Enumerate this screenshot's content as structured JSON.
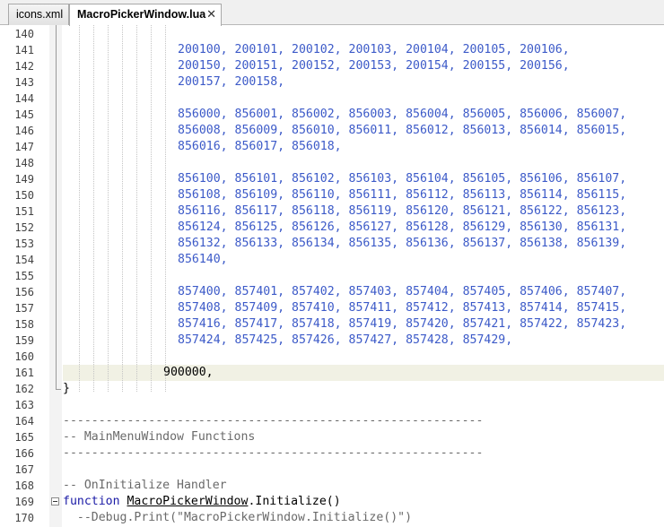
{
  "tabs": [
    {
      "label": "icons.xml",
      "active": false
    },
    {
      "label": "MacroPickerWindow.lua",
      "active": true,
      "close": "✕"
    }
  ],
  "lines": [
    {
      "n": "140",
      "text": ""
    },
    {
      "n": "141",
      "text": "200100, 200101, 200102, 200103, 200104, 200105, 200106,"
    },
    {
      "n": "142",
      "text": "200150, 200151, 200152, 200153, 200154, 200155, 200156,"
    },
    {
      "n": "143",
      "text": "200157, 200158,"
    },
    {
      "n": "144",
      "text": ""
    },
    {
      "n": "145",
      "text": "856000, 856001, 856002, 856003, 856004, 856005, 856006, 856007,"
    },
    {
      "n": "146",
      "text": "856008, 856009, 856010, 856011, 856012, 856013, 856014, 856015,"
    },
    {
      "n": "147",
      "text": "856016, 856017, 856018,"
    },
    {
      "n": "148",
      "text": ""
    },
    {
      "n": "149",
      "text": "856100, 856101, 856102, 856103, 856104, 856105, 856106, 856107,"
    },
    {
      "n": "150",
      "text": "856108, 856109, 856110, 856111, 856112, 856113, 856114, 856115,"
    },
    {
      "n": "151",
      "text": "856116, 856117, 856118, 856119, 856120, 856121, 856122, 856123,"
    },
    {
      "n": "152",
      "text": "856124, 856125, 856126, 856127, 856128, 856129, 856130, 856131,"
    },
    {
      "n": "153",
      "text": "856132, 856133, 856134, 856135, 856136, 856137, 856138, 856139,"
    },
    {
      "n": "154",
      "text": "856140,"
    },
    {
      "n": "155",
      "text": ""
    },
    {
      "n": "156",
      "text": "857400, 857401, 857402, 857403, 857404, 857405, 857406, 857407,"
    },
    {
      "n": "157",
      "text": "857408, 857409, 857410, 857411, 857412, 857413, 857414, 857415,"
    },
    {
      "n": "158",
      "text": "857416, 857417, 857418, 857419, 857420, 857421, 857422, 857423,"
    },
    {
      "n": "159",
      "text": "857424, 857425, 857426, 857427, 857428, 857429,"
    },
    {
      "n": "160",
      "text": ""
    },
    {
      "n": "161",
      "text": "900000,"
    },
    {
      "n": "162",
      "text": "}"
    },
    {
      "n": "163",
      "text": ""
    },
    {
      "n": "164",
      "text": "-----------------------------------------------------------"
    },
    {
      "n": "165",
      "text": "-- MainMenuWindow Functions"
    },
    {
      "n": "166",
      "text": "-----------------------------------------------------------"
    },
    {
      "n": "167",
      "text": ""
    },
    {
      "n": "168",
      "text": "-- OnInitialize Handler"
    },
    {
      "n": "169",
      "text": "function MacroPickerWindow.Initialize()"
    },
    {
      "n": "170",
      "text": "  --Debug.Print(\"MacroPickerWindow.Initialize()\")"
    }
  ]
}
